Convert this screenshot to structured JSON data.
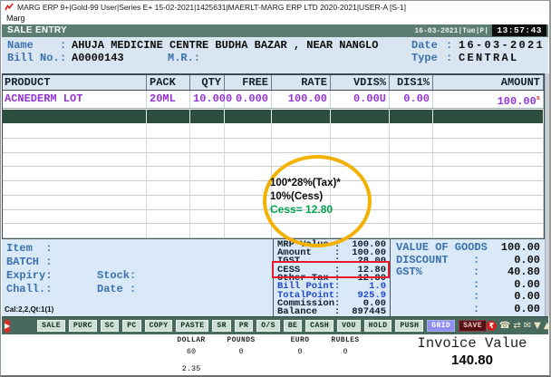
{
  "window_title": "MARG ERP 9+|Gold-99 User|Series E+ 15-02-2021|1425631|MAERLT-MARG ERP LTD 2020-2021|USER-A [S-1]",
  "menu": {
    "items": [
      "Marg"
    ]
  },
  "salebar": {
    "title": "SALE ENTRY",
    "datestamp": "16-03-2021|Tue|P|",
    "time": "13:57:43"
  },
  "billhead": {
    "name_label": "Name",
    "name_colon": ":",
    "name_value": "AHUJA MEDICINE CENTRE BUDHA BAZAR , NEAR NANGLO",
    "date_label": "Date",
    "date_colon": ":",
    "date_value": "16-03-2021",
    "billno_label": "Bill No.",
    "billno_colon": ":",
    "billno_value": "A0000143",
    "mr_label": "M.R.:",
    "type_label": "Type",
    "type_colon": ":",
    "type_value": "CENTRAL"
  },
  "table": {
    "columns": [
      "PRODUCT",
      "PACK",
      "QTY",
      "FREE",
      "RATE",
      "VDIS%",
      "DIS1%",
      "AMOUNT"
    ],
    "row": {
      "cells": [
        "ACNEDERM LOT",
        "20ML",
        "10.000",
        "0.000",
        "100.00",
        "0.00U",
        "0.00",
        "100.00"
      ],
      "amount_superscript": "s"
    }
  },
  "annotation": {
    "line1": "100*28%(Tax)*",
    "line2": "10%(Cess)",
    "line3": "Cess= 12.80",
    "circle_color": "#f2b103",
    "cess_color": "#00a24d",
    "highlight_color": "#ea1a2b"
  },
  "item_panel": {
    "item_label": "Item  :",
    "batch_label": "BATCH :",
    "expiry_label": "Expiry:",
    "stock_label": "Stock:",
    "chall_label": "Chall.:",
    "date_label": "Date :"
  },
  "status_line": "Cal:2,2,Qt:1(1)",
  "totals_panel": {
    "rows": [
      {
        "label": "MRP Value :",
        "value": "100.00",
        "accent": false,
        "highlight": false
      },
      {
        "label": "Amount    :",
        "value": "100.00",
        "accent": false,
        "highlight": false
      },
      {
        "label": "IGST      :",
        "value": "28.00",
        "accent": false,
        "highlight": false
      },
      {
        "label": "CESS      :",
        "value": "12.80",
        "accent": false,
        "highlight": true
      },
      {
        "label": "Other Tax :",
        "value": "12.80",
        "accent": false,
        "highlight": false
      },
      {
        "label": "Bill Point:",
        "value": "1.0",
        "accent": true,
        "highlight": false
      },
      {
        "label": "TotalPoint:",
        "value": "925.9",
        "accent": true,
        "highlight": false
      },
      {
        "label": "Commission:",
        "value": "0.00",
        "accent": false,
        "highlight": false
      },
      {
        "label": "Balance   :",
        "value": "897445",
        "accent": false,
        "highlight": false
      }
    ]
  },
  "summary_panel": {
    "rows": [
      {
        "label": "VALUE OF GOODS",
        "value": "100.00"
      },
      {
        "label": "DISCOUNT",
        "value": "0.00"
      },
      {
        "label": "GST%",
        "value": "40.80"
      },
      {
        "label": "",
        "value": "0.00"
      },
      {
        "label": "",
        "value": "0.00"
      },
      {
        "label": "",
        "value": "0.00"
      }
    ]
  },
  "toolbar": {
    "buttons": [
      "SALE",
      "PURC",
      "SC",
      "PC",
      "COPY",
      "PASTE",
      "SR",
      "PR",
      "O/S",
      "BE",
      "CASH",
      "VOU",
      "HOLD",
      "PUSH",
      "GRID",
      "SAVE"
    ],
    "play_glyph": "▶",
    "icons": [
      {
        "name": "rupee-icon",
        "glyph": "₹"
      },
      {
        "name": "phone-icon",
        "glyph": "☎"
      },
      {
        "name": "shuffle-icon",
        "glyph": "⇄"
      },
      {
        "name": "message-icon",
        "glyph": "✉"
      },
      {
        "name": "collapse-icon",
        "glyph": "▼"
      },
      {
        "name": "expand-icon",
        "glyph": "▲"
      },
      {
        "name": "arrow-up-icon",
        "glyph": "↑"
      },
      {
        "name": "arrow-down-icon",
        "glyph": "↓"
      },
      {
        "name": "print-icon",
        "glyph": "▤"
      },
      {
        "name": "exit-icon",
        "glyph": "→"
      }
    ]
  },
  "currency": {
    "columns": [
      {
        "label": "DOLLAR",
        "value": "60",
        "extra": "2.35"
      },
      {
        "label": "POUNDS",
        "value": "0",
        "extra": ""
      },
      {
        "label": "EURO",
        "value": "0",
        "extra": ""
      },
      {
        "label": "RUBLES",
        "value": "0",
        "extra": ""
      }
    ],
    "invoice_label": "Invoice Value",
    "invoice_value": "140.80"
  }
}
